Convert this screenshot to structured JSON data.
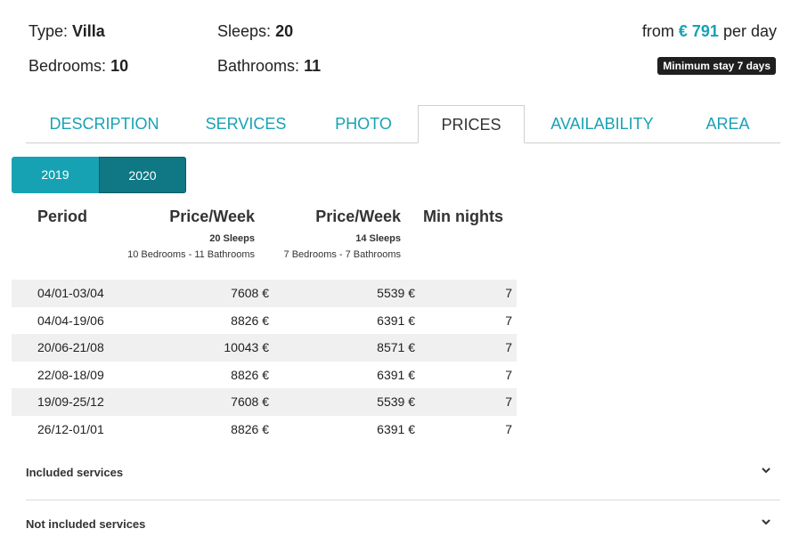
{
  "facts": {
    "type_label": "Type:",
    "type_value": "Villa",
    "sleeps_label": "Sleeps:",
    "sleeps_value": "20",
    "bedrooms_label": "Bedrooms:",
    "bedrooms_value": "10",
    "bathrooms_label": "Bathrooms:",
    "bathrooms_value": "11"
  },
  "price_from": {
    "prefix": "from",
    "amount": "€ 791",
    "suffix": "per day",
    "accent_color": "#17a2b3"
  },
  "min_stay_badge": "Minimum stay 7 days",
  "tabs": [
    {
      "label": "DESCRIPTION"
    },
    {
      "label": "SERVICES"
    },
    {
      "label": "PHOTO"
    },
    {
      "label": "PRICES",
      "active": true
    },
    {
      "label": "AVAILABILITY"
    },
    {
      "label": "AREA"
    }
  ],
  "years": [
    {
      "label": "2019"
    },
    {
      "label": "2020",
      "active": true
    }
  ],
  "table": {
    "headers": {
      "period": "Period",
      "price_week_1": "Price/Week",
      "price_week_1_sleeps": "20 Sleeps",
      "price_week_1_rooms": "10 Bedrooms - 11 Bathrooms",
      "price_week_2": "Price/Week",
      "price_week_2_sleeps": "14 Sleeps",
      "price_week_2_rooms": "7 Bedrooms - 7 Bathrooms",
      "min_nights": "Min nights"
    },
    "rows": [
      {
        "period": "04/01-03/04",
        "price1": "7608 €",
        "price2": "5539 €",
        "min": "7"
      },
      {
        "period": "04/04-19/06",
        "price1": "8826 €",
        "price2": "6391 €",
        "min": "7"
      },
      {
        "period": "20/06-21/08",
        "price1": "10043 €",
        "price2": "8571 €",
        "min": "7"
      },
      {
        "period": "22/08-18/09",
        "price1": "8826 €",
        "price2": "6391 €",
        "min": "7"
      },
      {
        "period": "19/09-25/12",
        "price1": "7608 €",
        "price2": "5539 €",
        "min": "7"
      },
      {
        "period": "26/12-01/01",
        "price1": "8826 €",
        "price2": "6391 €",
        "min": "7"
      }
    ]
  },
  "accordions": {
    "included": {
      "label": "Included services",
      "icon": "chevron-down-icon"
    },
    "not_included": {
      "label": "Not included services",
      "icon": "chevron-down-icon"
    }
  }
}
